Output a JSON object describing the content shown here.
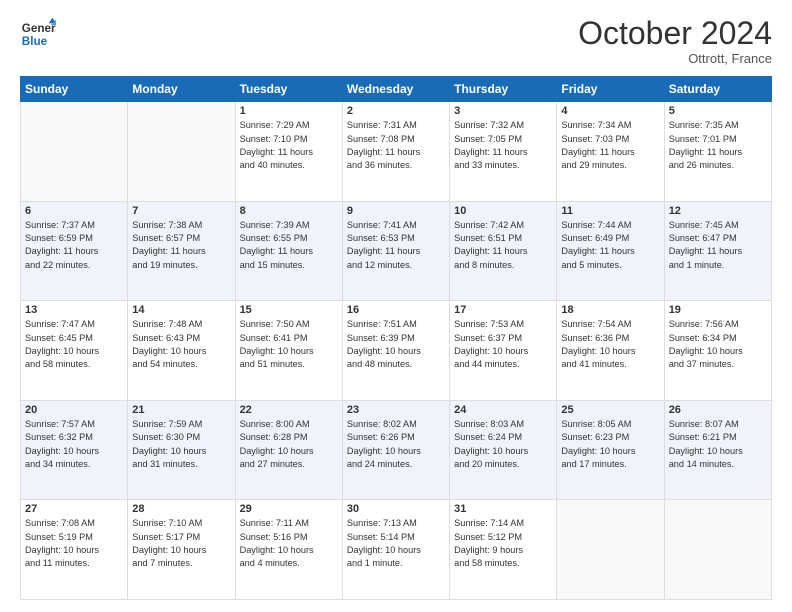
{
  "header": {
    "logo_line1": "General",
    "logo_line2": "Blue",
    "month": "October 2024",
    "location": "Ottrott, France"
  },
  "weekdays": [
    "Sunday",
    "Monday",
    "Tuesday",
    "Wednesday",
    "Thursday",
    "Friday",
    "Saturday"
  ],
  "weeks": [
    [
      {
        "day": "",
        "info": ""
      },
      {
        "day": "",
        "info": ""
      },
      {
        "day": "1",
        "info": "Sunrise: 7:29 AM\nSunset: 7:10 PM\nDaylight: 11 hours\nand 40 minutes."
      },
      {
        "day": "2",
        "info": "Sunrise: 7:31 AM\nSunset: 7:08 PM\nDaylight: 11 hours\nand 36 minutes."
      },
      {
        "day": "3",
        "info": "Sunrise: 7:32 AM\nSunset: 7:05 PM\nDaylight: 11 hours\nand 33 minutes."
      },
      {
        "day": "4",
        "info": "Sunrise: 7:34 AM\nSunset: 7:03 PM\nDaylight: 11 hours\nand 29 minutes."
      },
      {
        "day": "5",
        "info": "Sunrise: 7:35 AM\nSunset: 7:01 PM\nDaylight: 11 hours\nand 26 minutes."
      }
    ],
    [
      {
        "day": "6",
        "info": "Sunrise: 7:37 AM\nSunset: 6:59 PM\nDaylight: 11 hours\nand 22 minutes."
      },
      {
        "day": "7",
        "info": "Sunrise: 7:38 AM\nSunset: 6:57 PM\nDaylight: 11 hours\nand 19 minutes."
      },
      {
        "day": "8",
        "info": "Sunrise: 7:39 AM\nSunset: 6:55 PM\nDaylight: 11 hours\nand 15 minutes."
      },
      {
        "day": "9",
        "info": "Sunrise: 7:41 AM\nSunset: 6:53 PM\nDaylight: 11 hours\nand 12 minutes."
      },
      {
        "day": "10",
        "info": "Sunrise: 7:42 AM\nSunset: 6:51 PM\nDaylight: 11 hours\nand 8 minutes."
      },
      {
        "day": "11",
        "info": "Sunrise: 7:44 AM\nSunset: 6:49 PM\nDaylight: 11 hours\nand 5 minutes."
      },
      {
        "day": "12",
        "info": "Sunrise: 7:45 AM\nSunset: 6:47 PM\nDaylight: 11 hours\nand 1 minute."
      }
    ],
    [
      {
        "day": "13",
        "info": "Sunrise: 7:47 AM\nSunset: 6:45 PM\nDaylight: 10 hours\nand 58 minutes."
      },
      {
        "day": "14",
        "info": "Sunrise: 7:48 AM\nSunset: 6:43 PM\nDaylight: 10 hours\nand 54 minutes."
      },
      {
        "day": "15",
        "info": "Sunrise: 7:50 AM\nSunset: 6:41 PM\nDaylight: 10 hours\nand 51 minutes."
      },
      {
        "day": "16",
        "info": "Sunrise: 7:51 AM\nSunset: 6:39 PM\nDaylight: 10 hours\nand 48 minutes."
      },
      {
        "day": "17",
        "info": "Sunrise: 7:53 AM\nSunset: 6:37 PM\nDaylight: 10 hours\nand 44 minutes."
      },
      {
        "day": "18",
        "info": "Sunrise: 7:54 AM\nSunset: 6:36 PM\nDaylight: 10 hours\nand 41 minutes."
      },
      {
        "day": "19",
        "info": "Sunrise: 7:56 AM\nSunset: 6:34 PM\nDaylight: 10 hours\nand 37 minutes."
      }
    ],
    [
      {
        "day": "20",
        "info": "Sunrise: 7:57 AM\nSunset: 6:32 PM\nDaylight: 10 hours\nand 34 minutes."
      },
      {
        "day": "21",
        "info": "Sunrise: 7:59 AM\nSunset: 6:30 PM\nDaylight: 10 hours\nand 31 minutes."
      },
      {
        "day": "22",
        "info": "Sunrise: 8:00 AM\nSunset: 6:28 PM\nDaylight: 10 hours\nand 27 minutes."
      },
      {
        "day": "23",
        "info": "Sunrise: 8:02 AM\nSunset: 6:26 PM\nDaylight: 10 hours\nand 24 minutes."
      },
      {
        "day": "24",
        "info": "Sunrise: 8:03 AM\nSunset: 6:24 PM\nDaylight: 10 hours\nand 20 minutes."
      },
      {
        "day": "25",
        "info": "Sunrise: 8:05 AM\nSunset: 6:23 PM\nDaylight: 10 hours\nand 17 minutes."
      },
      {
        "day": "26",
        "info": "Sunrise: 8:07 AM\nSunset: 6:21 PM\nDaylight: 10 hours\nand 14 minutes."
      }
    ],
    [
      {
        "day": "27",
        "info": "Sunrise: 7:08 AM\nSunset: 5:19 PM\nDaylight: 10 hours\nand 11 minutes."
      },
      {
        "day": "28",
        "info": "Sunrise: 7:10 AM\nSunset: 5:17 PM\nDaylight: 10 hours\nand 7 minutes."
      },
      {
        "day": "29",
        "info": "Sunrise: 7:11 AM\nSunset: 5:16 PM\nDaylight: 10 hours\nand 4 minutes."
      },
      {
        "day": "30",
        "info": "Sunrise: 7:13 AM\nSunset: 5:14 PM\nDaylight: 10 hours\nand 1 minute."
      },
      {
        "day": "31",
        "info": "Sunrise: 7:14 AM\nSunset: 5:12 PM\nDaylight: 9 hours\nand 58 minutes."
      },
      {
        "day": "",
        "info": ""
      },
      {
        "day": "",
        "info": ""
      }
    ]
  ]
}
